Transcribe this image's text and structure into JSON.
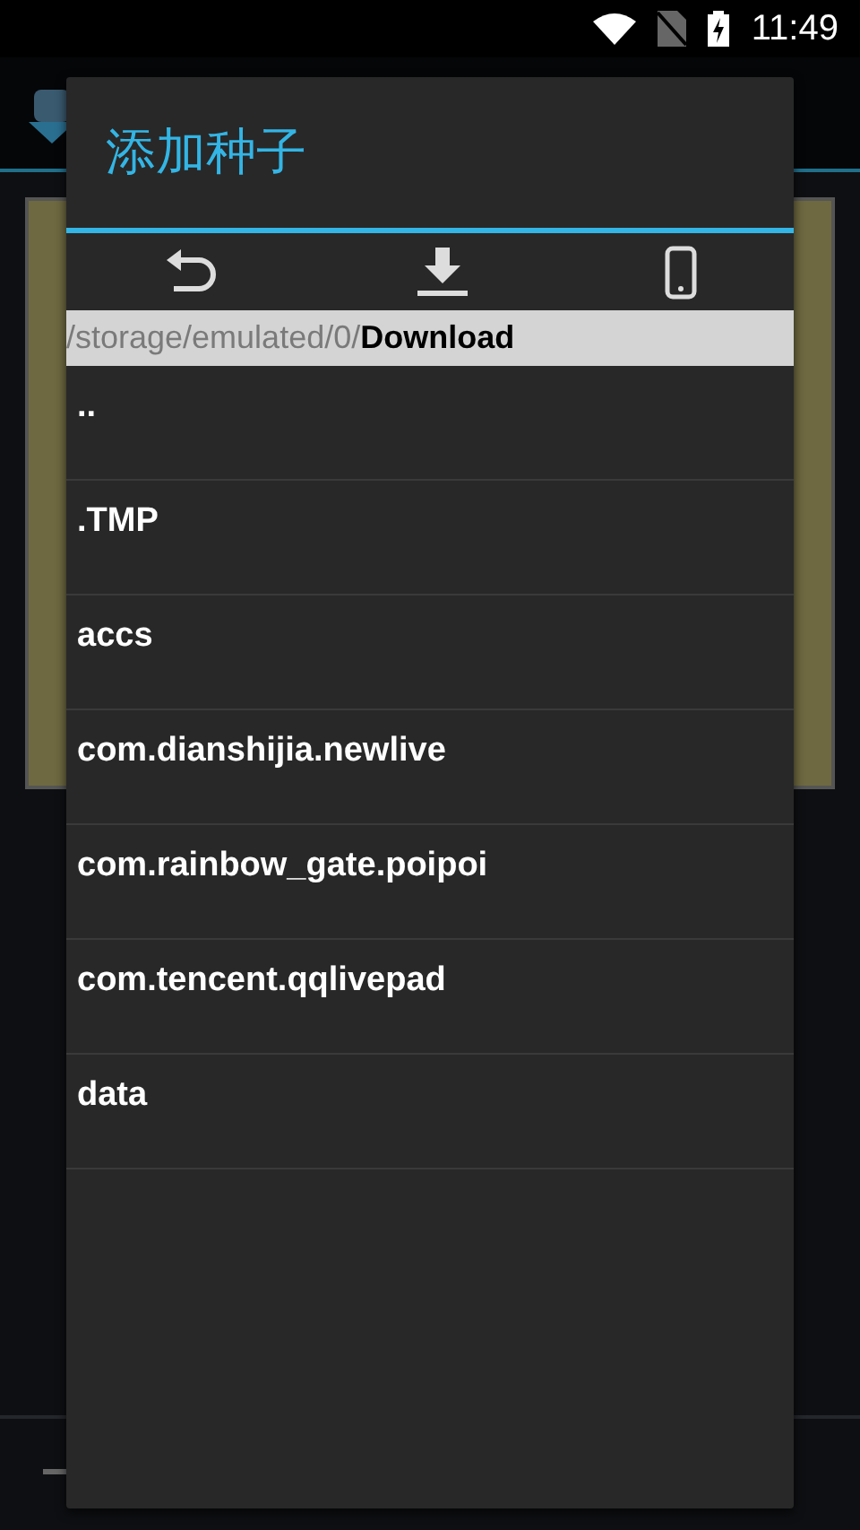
{
  "status_bar": {
    "time": "11:49"
  },
  "dialog": {
    "title": "添加种子",
    "path": {
      "parent": "/storage/emulated/0/",
      "current": "Download"
    },
    "entries": [
      {
        "name": ".."
      },
      {
        "name": ".TMP"
      },
      {
        "name": "accs"
      },
      {
        "name": "com.dianshijia.newlive"
      },
      {
        "name": "com.rainbow_gate.poipoi"
      },
      {
        "name": "com.tencent.qqlivepad"
      },
      {
        "name": "data"
      }
    ]
  }
}
